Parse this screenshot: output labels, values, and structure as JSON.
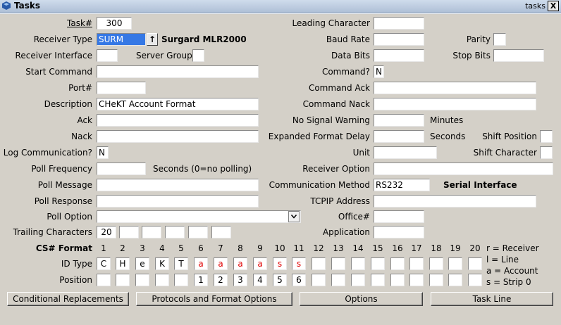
{
  "window": {
    "title": "Tasks",
    "right_label": "tasks",
    "close_label": "X"
  },
  "left": {
    "task_label": "Task#",
    "task_value": "300",
    "receiver_type_label": "Receiver Type",
    "receiver_type_value": "SURM",
    "receiver_type_btn": "↑",
    "receiver_type_desc": "Surgard MLR2000",
    "receiver_interface_label": "Receiver Interface",
    "receiver_interface_value": "",
    "server_group_label": "Server Group",
    "server_group_value": "",
    "start_command_label": "Start Command",
    "start_command_value": "",
    "port_label": "Port#",
    "port_value": "",
    "description_label": "Description",
    "description_value": "CHeKT Account Format",
    "ack_label": "Ack",
    "ack_value": "",
    "nack_label": "Nack",
    "nack_value": "",
    "log_comm_label": "Log Communication?",
    "log_comm_value": "N",
    "poll_freq_label": "Poll Frequency",
    "poll_freq_value": "",
    "poll_freq_note": "Seconds (0=no polling)",
    "poll_message_label": "Poll Message",
    "poll_message_value": "",
    "poll_response_label": "Poll Response",
    "poll_response_value": "",
    "poll_option_label": "Poll Option",
    "poll_option_value": "",
    "trailing_label": "Trailing Characters",
    "trailing_values": [
      "20",
      "",
      "",
      "",
      "",
      ""
    ]
  },
  "right": {
    "leading_char_label": "Leading Character",
    "leading_char_value": "",
    "baud_label": "Baud Rate",
    "baud_value": "",
    "parity_label": "Parity",
    "parity_value": "",
    "data_bits_label": "Data Bits",
    "data_bits_value": "",
    "stop_bits_label": "Stop Bits",
    "stop_bits_value": "",
    "command_q_label": "Command?",
    "command_q_value": "N",
    "command_ack_label": "Command Ack",
    "command_ack_value": "",
    "command_nack_label": "Command Nack",
    "command_nack_value": "",
    "no_signal_label": "No Signal Warning",
    "no_signal_value": "",
    "no_signal_unit": "Minutes",
    "exp_delay_label": "Expanded Format Delay",
    "exp_delay_value": "",
    "exp_delay_unit": "Seconds",
    "shift_pos_label": "Shift Position",
    "shift_pos_value": "",
    "unit_label": "Unit",
    "unit_value": "",
    "shift_char_label": "Shift Character",
    "shift_char_value": "",
    "receiver_option_label": "Receiver Option",
    "receiver_option_value": "",
    "comm_method_label": "Communication Method",
    "comm_method_value": "RS232",
    "comm_method_desc": "Serial Interface",
    "tcpip_label": "TCPIP Address",
    "tcpip_value": "",
    "office_label": "Office#",
    "office_value": "",
    "application_label": "Application",
    "application_value": ""
  },
  "cs": {
    "header_label": "CS# Format",
    "numbers": [
      "1",
      "2",
      "3",
      "4",
      "5",
      "6",
      "7",
      "8",
      "9",
      "10",
      "11",
      "12",
      "13",
      "14",
      "15",
      "16",
      "17",
      "18",
      "19",
      "20"
    ],
    "id_type_label": "ID Type",
    "id_type": [
      "C",
      "H",
      "e",
      "K",
      "T",
      "a",
      "a",
      "a",
      "a",
      "s",
      "s",
      "",
      "",
      "",
      "",
      "",
      "",
      "",
      "",
      ""
    ],
    "position_label": "Position",
    "position": [
      "",
      "",
      "",
      "",
      "",
      "1",
      "2",
      "3",
      "4",
      "5",
      "6",
      "",
      "",
      "",
      "",
      "",
      "",
      "",
      "",
      ""
    ],
    "legend": [
      "r = Receiver",
      "l = Line",
      "a = Account",
      "s = Strip 0"
    ]
  },
  "buttons": {
    "conditional": "Conditional Replacements",
    "protocols": "Protocols and Format Options",
    "options": "Options",
    "task_line": "Task Line"
  }
}
